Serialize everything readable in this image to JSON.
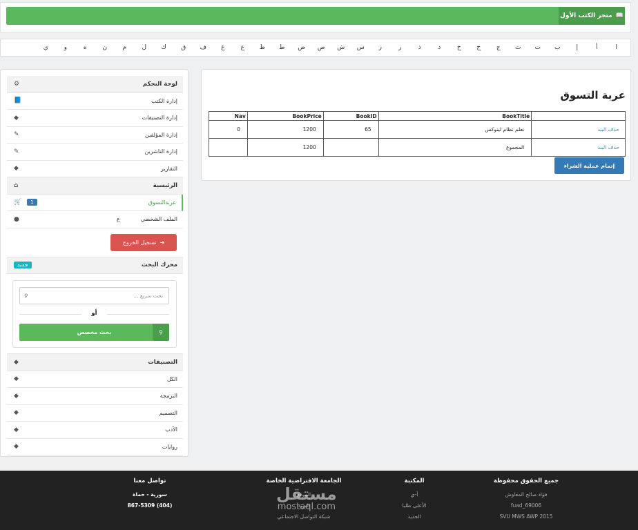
{
  "header": {
    "brand": "متجر الكتب الأول",
    "brand_icon": "book-icon"
  },
  "alphabet": [
    "ا",
    "أ",
    "إ",
    "ب",
    "ت",
    "ث",
    "ج",
    "ح",
    "خ",
    "د",
    "ذ",
    "ر",
    "ز",
    "س",
    "ش",
    "ص",
    "ض",
    "ط",
    "ظ",
    "ع",
    "غ",
    "ف",
    "ق",
    "ك",
    "ل",
    "م",
    "ن",
    "ه",
    "و",
    "ي"
  ],
  "sidebar": {
    "control_panel": {
      "title": "لوحة التحكم",
      "items": [
        {
          "label": "إدارة الكتب",
          "icon": "book-icon"
        },
        {
          "label": "إدارة التصنيفات",
          "icon": "tag-icon"
        },
        {
          "label": "إدارة المؤلفين",
          "icon": "edit-icon"
        },
        {
          "label": "إدارة الناشرين",
          "icon": "edit-icon"
        },
        {
          "label": "التقارير",
          "icon": "tag-icon"
        }
      ]
    },
    "home": {
      "title": "الرئيسية",
      "cart_label": "عربةالتسوق",
      "cart_count": "1",
      "profile_label": "الملف الشخصي",
      "profile_initial": "ع"
    },
    "logout_label": "تسجيل الخروج",
    "search": {
      "title": "محرك البحث",
      "badge": "جديد",
      "placeholder": "بحث سريع ...",
      "or_label": "أو",
      "custom_label": "بحث مخصص"
    },
    "categories": {
      "title": "التصنيفات",
      "items": [
        "الكل",
        "البرمجة",
        "التصميم",
        "الأدب",
        "روايات"
      ]
    }
  },
  "cart": {
    "title": "عربة التسوق",
    "columns": [
      "Nav",
      "BookPrice",
      "BookID",
      "BookTitle",
      ""
    ],
    "rows": [
      {
        "nav": "0",
        "price": "1200",
        "id": "65",
        "title": "تعلم نظام لينوكس",
        "action": "حذف البند"
      },
      {
        "nav": "",
        "price": "1200",
        "id": "",
        "title": "المجموع",
        "action": "حذف البند"
      }
    ],
    "buy_label": "إتمام عملية الشراء"
  },
  "footer": {
    "col1": {
      "title": "جميع الحقوق محفوظة",
      "lines": [
        "فؤاد صالح المعاوش",
        "fuad_69006",
        "SVU MWS AWP 2015"
      ]
    },
    "col2": {
      "title": "المكتبة",
      "lines": [
        "أ-ي",
        "الأعلى طلبا",
        "الجديد"
      ]
    },
    "col3": {
      "title": "الجامعة الافتراضية الخاصة",
      "lines": [
        "الموقع",
        "البريد",
        "شبكة التواصل الاجتماعي"
      ]
    },
    "col4": {
      "title": "تواصل معنا",
      "lines": [
        "سورية - حماة",
        "(404) 867-5309"
      ]
    },
    "watermark_ar": "مستقل",
    "watermark_en": "mostaql.com"
  }
}
